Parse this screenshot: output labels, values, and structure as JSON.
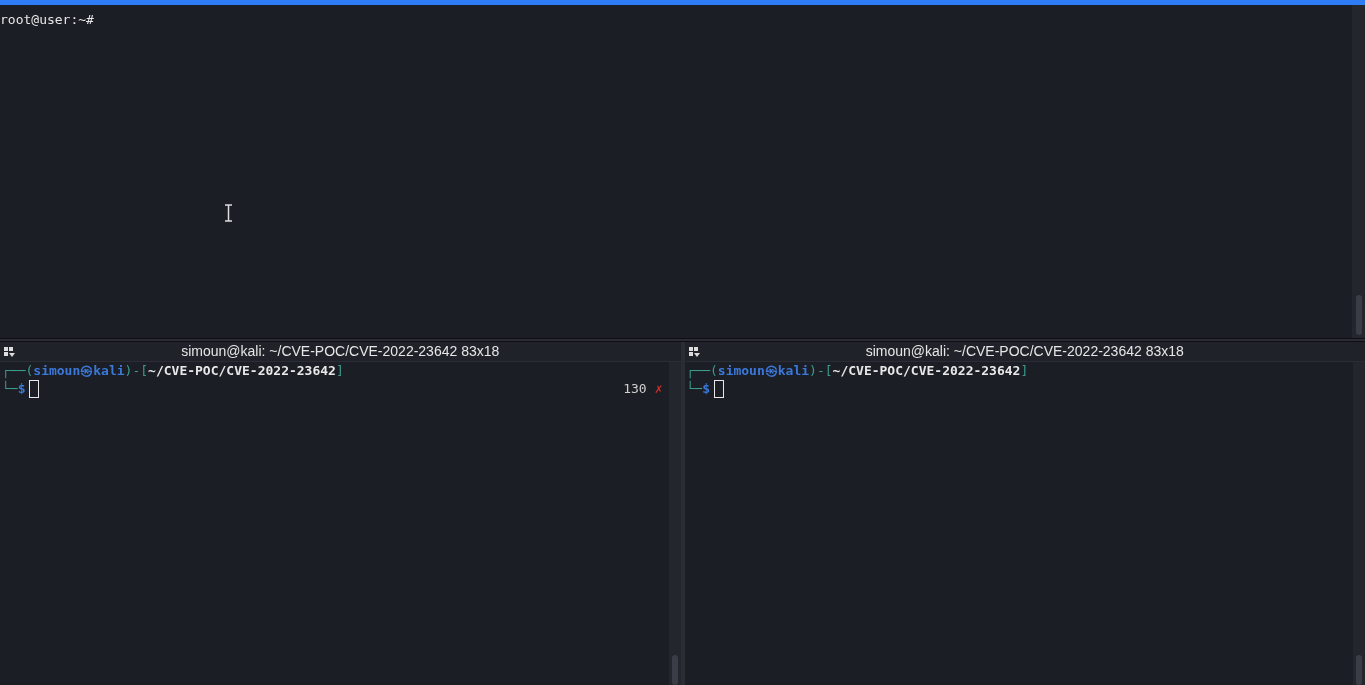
{
  "top_pane": {
    "prompt": "root@user:~#"
  },
  "panes": [
    {
      "title": "simoun@kali: ~/CVE-POC/CVE-2022-23642 83x18",
      "line_1": [
        {
          "kind": "frame",
          "text": "┌──("
        },
        {
          "kind": "user",
          "text": "simoun㉿kali"
        },
        {
          "kind": "frame",
          "text": ")-["
        },
        {
          "kind": "path",
          "text": "~/CVE-POC/CVE-2022-23642"
        },
        {
          "kind": "frame",
          "text": "]"
        }
      ],
      "line_2": [
        {
          "kind": "frame",
          "text": "└─"
        },
        {
          "kind": "user",
          "text": "$"
        }
      ],
      "exit_code": "130",
      "error_mark": "✗"
    },
    {
      "title": "simoun@kali: ~/CVE-POC/CVE-2022-23642 83x18",
      "line_1": [
        {
          "kind": "frame",
          "text": "┌──("
        },
        {
          "kind": "user",
          "text": "simoun㉿kali"
        },
        {
          "kind": "frame",
          "text": ")-["
        },
        {
          "kind": "path",
          "text": "~/CVE-POC/CVE-2022-23642"
        },
        {
          "kind": "frame",
          "text": "]"
        }
      ],
      "line_2": [
        {
          "kind": "frame",
          "text": "└─"
        },
        {
          "kind": "user",
          "text": "$"
        }
      ]
    }
  ]
}
